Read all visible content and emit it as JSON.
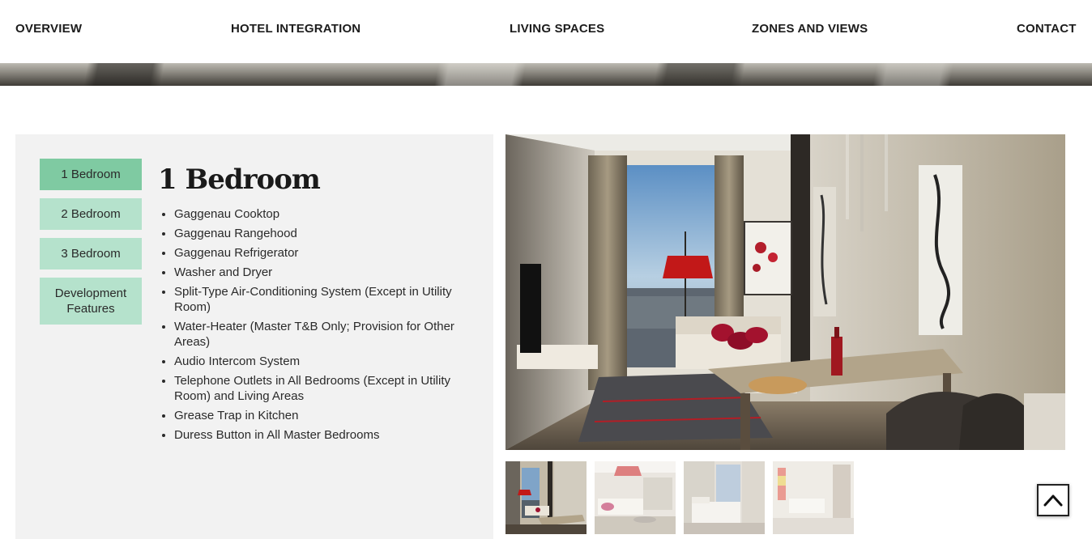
{
  "nav": {
    "items": [
      {
        "label": "OVERVIEW"
      },
      {
        "label": "HOTEL INTEGRATION"
      },
      {
        "label": "LIVING SPACES"
      },
      {
        "label": "ZONES AND VIEWS"
      },
      {
        "label": "CONTACT"
      }
    ]
  },
  "tabs": [
    {
      "label": "1 Bedroom",
      "active": true
    },
    {
      "label": "2 Bedroom",
      "active": false
    },
    {
      "label": "3 Bedroom",
      "active": false
    },
    {
      "label_line1": "Development",
      "label_line2": "Features",
      "active": false
    }
  ],
  "unit": {
    "title": "1 Bedroom",
    "features": [
      "Gaggenau Cooktop",
      "Gaggenau Rangehood",
      "Gaggenau Refrigerator",
      "Washer and Dryer",
      "Split-Type Air-Conditioning System (Except in Utility Room)",
      "Water-Heater (Master T&B Only; Provision for Other Areas)",
      "Audio Intercom System",
      "Telephone Outlets in All Bedrooms (Except in Utility Room) and Living Areas",
      "Grease Trap in Kitchen",
      "Duress Button in All Master Bedrooms"
    ]
  },
  "gallery": {
    "thumbnails": [
      {
        "name": "living-dining-thumb",
        "active": true
      },
      {
        "name": "living-room-thumb",
        "active": false
      },
      {
        "name": "bedroom-thumb",
        "active": false
      },
      {
        "name": "bathroom-thumb",
        "active": false
      }
    ]
  },
  "icons": {
    "back_to_top": "chevron-up-icon"
  },
  "colors": {
    "tab_active": "#7fcaa2",
    "tab_inactive": "#b5e2cc",
    "panel_bg": "#f2f2f2"
  }
}
